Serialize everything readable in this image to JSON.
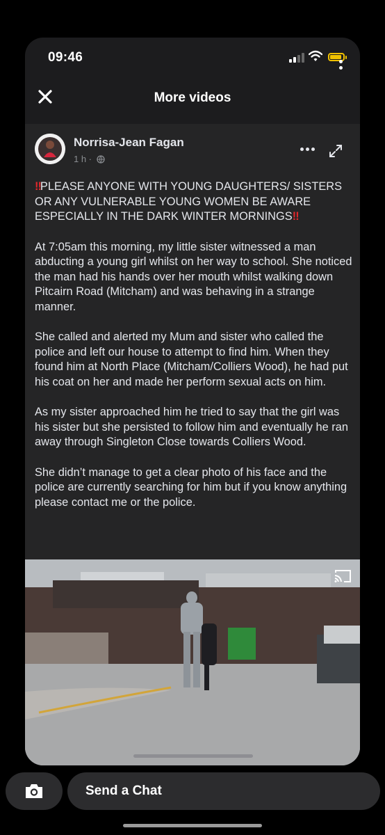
{
  "status": {
    "time": "09:46"
  },
  "header": {
    "title": "More videos"
  },
  "post": {
    "author": "Norrisa-Jean Fagan",
    "time": "1 h ·",
    "alert_marks": "‼",
    "alert_text": "PLEASE ANYONE WITH YOUNG DAUGHTERS/ SISTERS OR ANY VULNERABLE YOUNG WOMEN BE AWARE ESPECIALLY IN THE DARK WINTER MORNINGS",
    "paragraphs": [
      "At 7:05am this morning, my little sister witnessed a man abducting a young girl whilst on her way to school. She noticed the man had his hands over her mouth whilst walking down Pitcairn Road (Mitcham) and was behaving in a strange manner.",
      "She called and alerted my Mum and sister who called the police and left our house to attempt to find him. When they found him at North Place (Mitcham/Colliers Wood), he had put his coat on her and made her perform sexual acts on him.",
      "As my sister approached him he tried to say that the girl was his sister but she persisted to follow him and eventually he ran away through Singleton Close towards Colliers Wood.",
      "She didn’t manage to get a clear photo of his face and the police are currently searching for him but if you know anything please contact me or the police."
    ]
  },
  "chat": {
    "placeholder": "Send a Chat"
  },
  "icons": {
    "close": "close-icon",
    "more": "more-dots-icon",
    "expand": "expand-icon",
    "cast": "cast-icon",
    "camera": "camera-icon",
    "globe": "globe-icon"
  },
  "colors": {
    "alert_red": "#e0282c",
    "battery_yellow": "#f2c200",
    "card_bg": "#252526"
  }
}
